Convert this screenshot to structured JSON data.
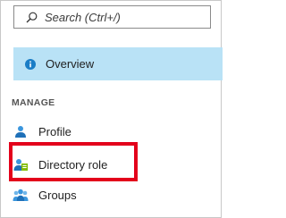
{
  "search": {
    "placeholder": "Search (Ctrl+/)",
    "icon": "search-icon"
  },
  "overview": {
    "label": "Overview",
    "icon": "info-icon",
    "selected": true,
    "highlight_color": "#b9e2f6"
  },
  "sections": {
    "manage": {
      "title": "MANAGE",
      "items": [
        {
          "label": "Profile",
          "icon": "user-profile-icon"
        },
        {
          "label": "Directory role",
          "icon": "directory-role-icon"
        },
        {
          "label": "Groups",
          "icon": "groups-icon"
        }
      ]
    }
  },
  "annotation": {
    "highlighted_item": "Directory role",
    "color": "#e3001b"
  }
}
